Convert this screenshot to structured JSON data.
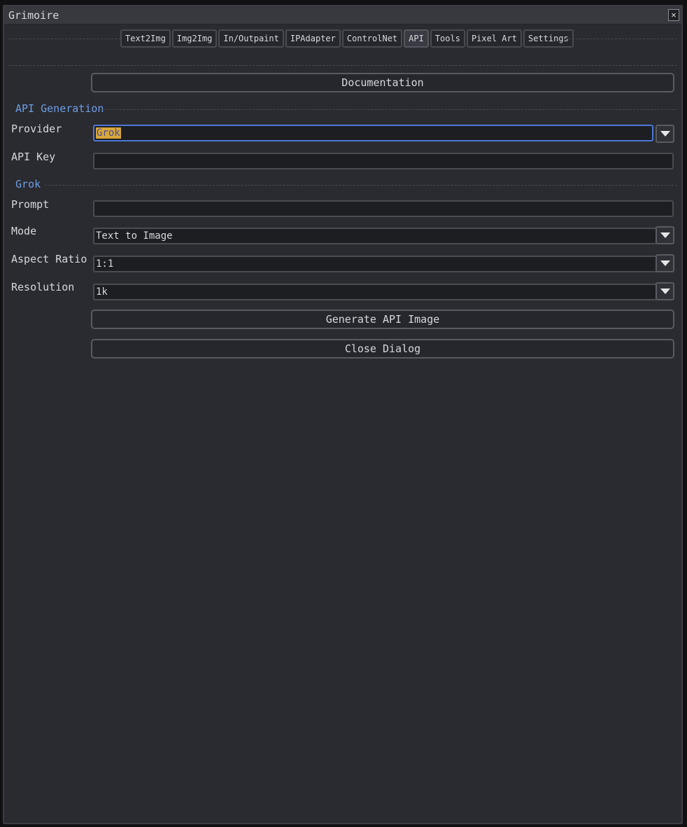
{
  "window": {
    "title": "Grimoire",
    "close_glyph": "✕"
  },
  "tabs": [
    {
      "label": "Text2Img"
    },
    {
      "label": "Img2Img"
    },
    {
      "label": "In/Outpaint"
    },
    {
      "label": "IPAdapter"
    },
    {
      "label": "ControlNet"
    },
    {
      "label": "API",
      "active": true
    },
    {
      "label": "Tools"
    },
    {
      "label": "Pixel Art"
    },
    {
      "label": "Settings"
    }
  ],
  "documentation_button": "Documentation",
  "sections": {
    "api_generation": "API Generation",
    "grok": "Grok"
  },
  "fields": {
    "provider": {
      "label": "Provider",
      "value": "Grok"
    },
    "api_key": {
      "label": "API Key",
      "value": ""
    },
    "prompt": {
      "label": "Prompt",
      "value": ""
    },
    "mode": {
      "label": "Mode",
      "value": "Text to Image"
    },
    "aspect_ratio": {
      "label": "Aspect Ratio",
      "value": "1:1"
    },
    "resolution": {
      "label": "Resolution",
      "value": "1k"
    }
  },
  "buttons": {
    "generate": "Generate API Image",
    "close": "Close Dialog"
  },
  "colors": {
    "section_accent": "#6e9ee6",
    "focus_border": "#4e78d6",
    "selection_highlight": "#d9a63b"
  }
}
